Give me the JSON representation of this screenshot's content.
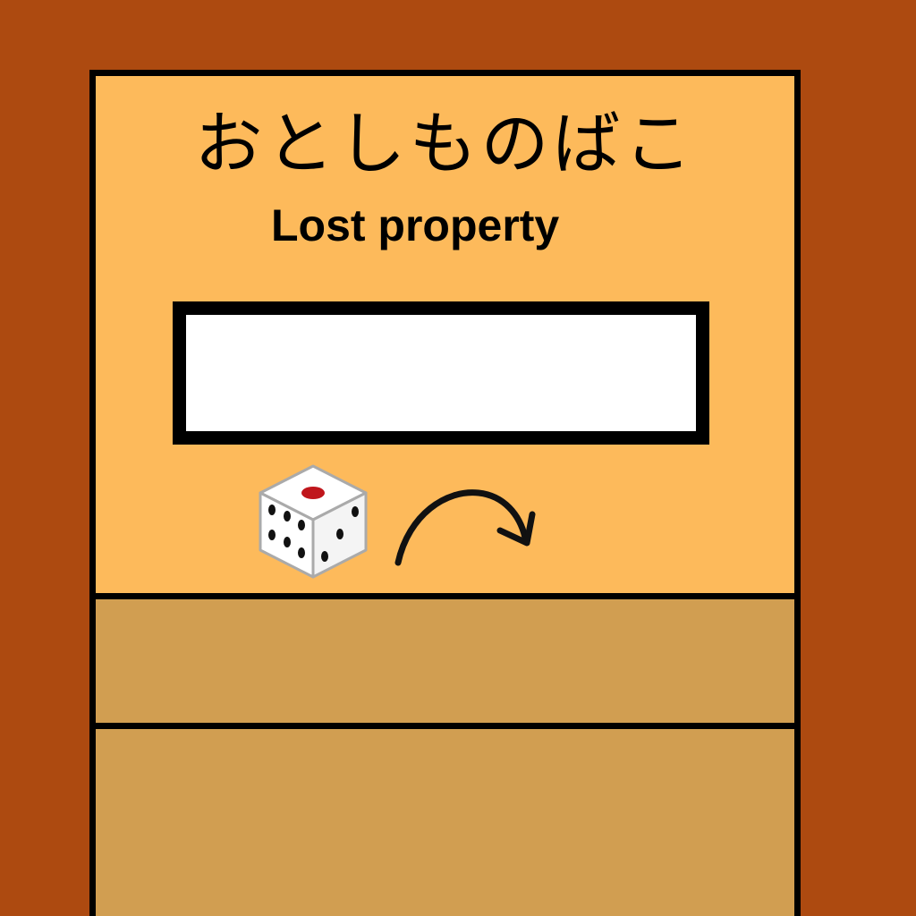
{
  "sign": {
    "title_japanese": "おとしものばこ",
    "title_english": "Lost property"
  },
  "slot": {
    "state": "empty"
  },
  "icons": {
    "item": "dice-icon",
    "action": "curved-arrow-right-icon"
  },
  "colors": {
    "background": "#ad4a10",
    "box_top": "#fdba5b",
    "box_bottom": "#d19e51",
    "slot": "#ffffff",
    "outline": "#000000",
    "dice_pip_red": "#c0161c"
  }
}
